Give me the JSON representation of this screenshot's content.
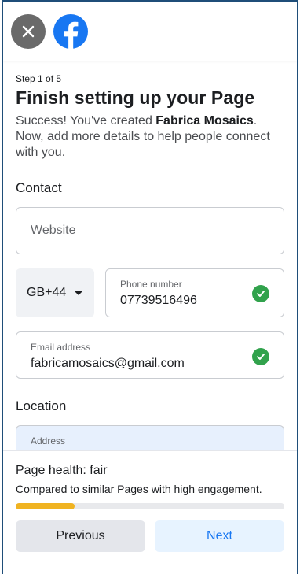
{
  "header": {
    "close_icon": "close-icon",
    "logo_icon": "facebook-logo-icon",
    "brand_color": "#1877F2"
  },
  "main": {
    "step": "Step 1 of 5",
    "title": "Finish setting up your Page",
    "desc_prefix": "Success! You've created ",
    "page_name": "Fabrica Mosaics",
    "desc_suffix": ". Now, add more details to help people connect with you."
  },
  "contact": {
    "heading": "Contact",
    "website_placeholder": "Website",
    "country_code": "GB+44",
    "phone_label": "Phone number",
    "phone_value": "07739516496",
    "email_label": "Email address",
    "email_value": "fabricamosaics@gmail.com",
    "valid_color": "#31A24C"
  },
  "location": {
    "heading": "Location",
    "address_label": "Address"
  },
  "health": {
    "title": "Page health: fair",
    "description": "Compared to similar Pages with high engagement.",
    "progress": 0.22,
    "bar_color": "#F0B321"
  },
  "footer": {
    "previous_label": "Previous",
    "next_label": "Next"
  }
}
